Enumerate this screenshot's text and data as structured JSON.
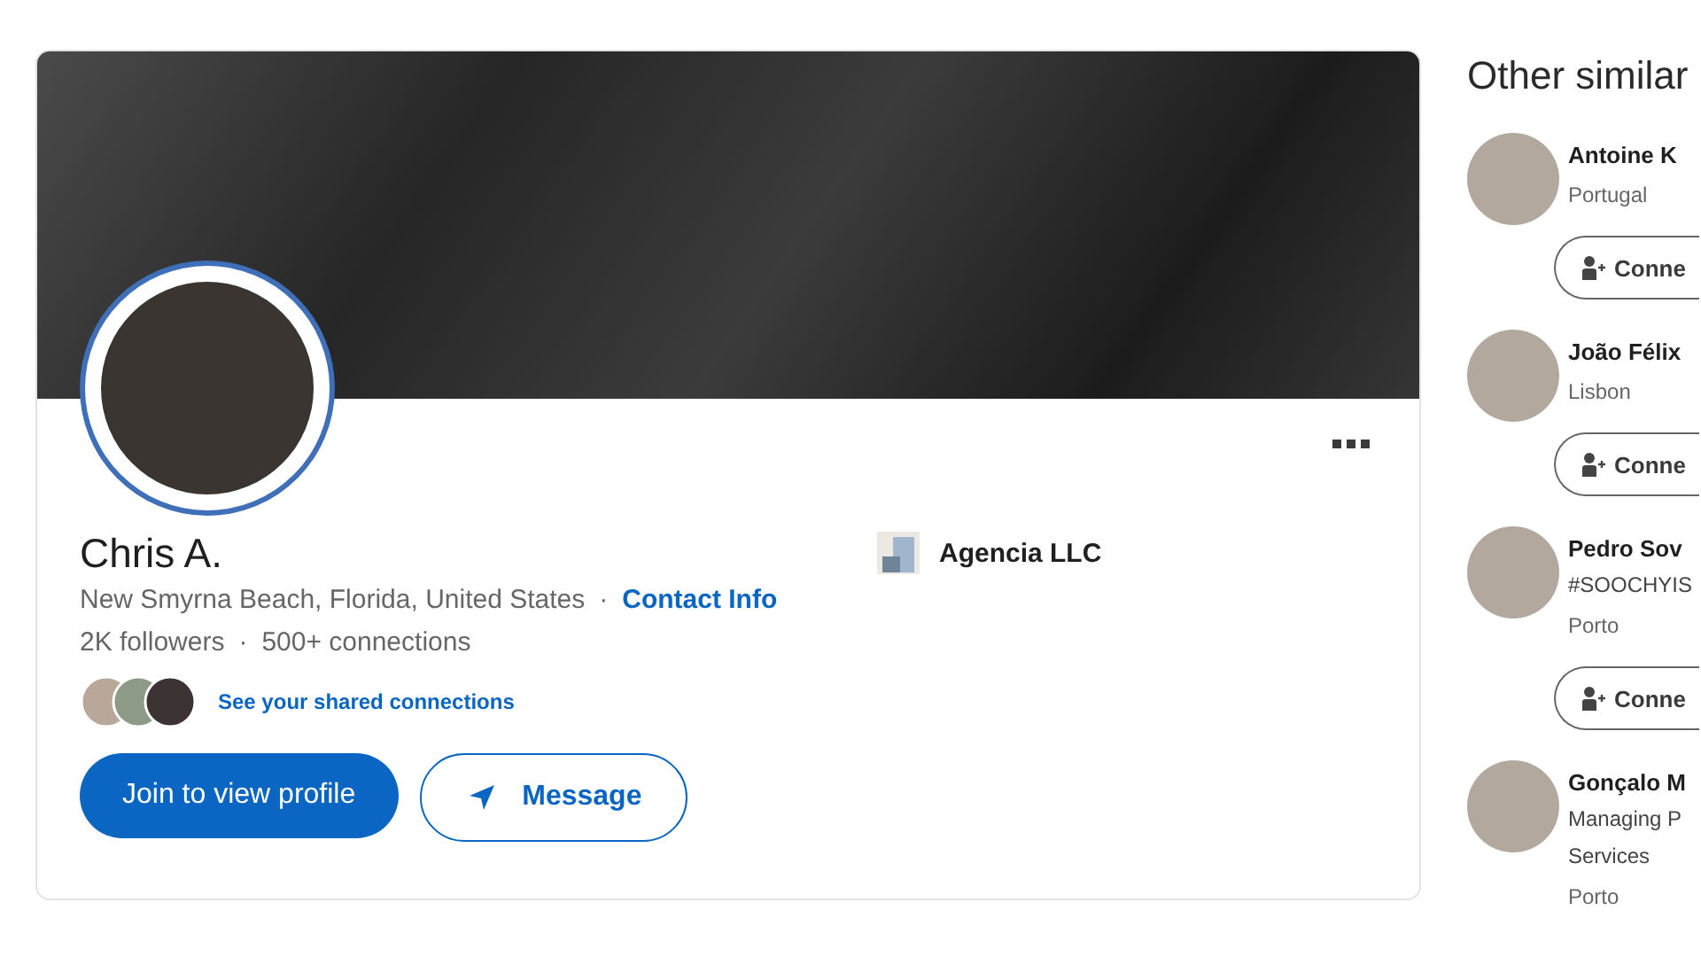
{
  "profile": {
    "name": "Chris A.",
    "location": "New Smyrna Beach, Florida, United States",
    "separator": "·",
    "contact_link": "Contact Info",
    "followers": "2K followers",
    "connections": "500+ connections",
    "shared_link": "See your shared connections",
    "join_button": "Join to view profile",
    "message_button": "Message",
    "company": "Agencia LLC"
  },
  "similar": {
    "title": "Other similar",
    "people": [
      {
        "name": "Antoine K",
        "location": "Portugal",
        "connect_label": "Conne"
      },
      {
        "name": "João Félix",
        "location": "Lisbon",
        "connect_label": "Conne"
      },
      {
        "name": "Pedro Sov",
        "headline_lines": [
          "#SOOCHYIS"
        ],
        "location": "Porto",
        "connect_label": "Conne"
      },
      {
        "name": "Gonçalo M",
        "headline_lines": [
          "Managing P",
          "Services"
        ],
        "location": "Porto"
      }
    ]
  }
}
